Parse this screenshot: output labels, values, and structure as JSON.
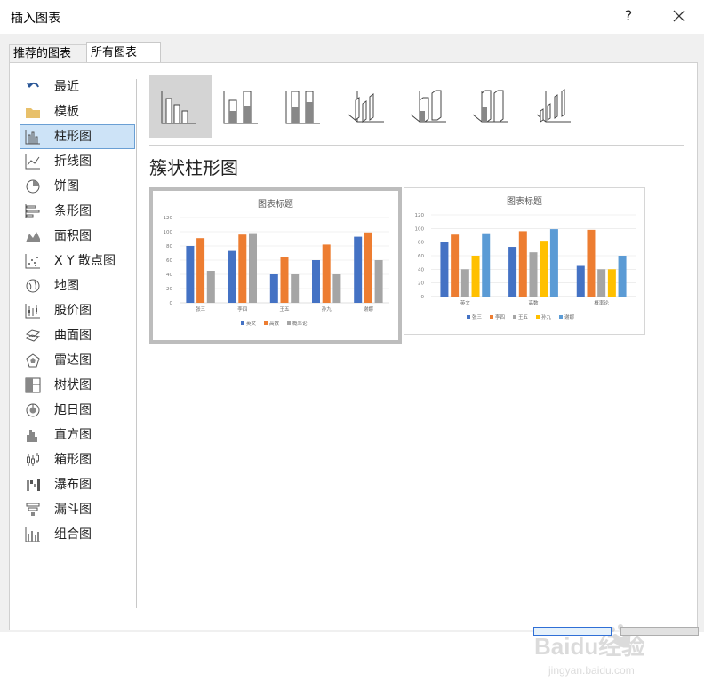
{
  "window": {
    "title": "插入图表",
    "help": "?",
    "close": "×"
  },
  "tabs": [
    {
      "label": "推荐的图表",
      "selected": false
    },
    {
      "label": "所有图表",
      "selected": true
    }
  ],
  "sidebar": {
    "items": [
      {
        "label": "最近",
        "icon": "undo-arrow-icon"
      },
      {
        "label": "模板",
        "icon": "folder-icon"
      },
      {
        "label": "柱形图",
        "icon": "column-chart-icon",
        "selected": true
      },
      {
        "label": "折线图",
        "icon": "line-chart-icon"
      },
      {
        "label": "饼图",
        "icon": "pie-chart-icon"
      },
      {
        "label": "条形图",
        "icon": "bar-chart-icon"
      },
      {
        "label": "面积图",
        "icon": "area-chart-icon"
      },
      {
        "label": "X Y 散点图",
        "icon": "scatter-chart-icon"
      },
      {
        "label": "地图",
        "icon": "map-globe-icon"
      },
      {
        "label": "股价图",
        "icon": "stock-chart-icon"
      },
      {
        "label": "曲面图",
        "icon": "surface-chart-icon"
      },
      {
        "label": "雷达图",
        "icon": "radar-chart-icon"
      },
      {
        "label": "树状图",
        "icon": "treemap-icon"
      },
      {
        "label": "旭日图",
        "icon": "sunburst-icon"
      },
      {
        "label": "直方图",
        "icon": "histogram-icon"
      },
      {
        "label": "箱形图",
        "icon": "box-whisker-icon"
      },
      {
        "label": "瀑布图",
        "icon": "waterfall-icon"
      },
      {
        "label": "漏斗图",
        "icon": "funnel-icon"
      },
      {
        "label": "组合图",
        "icon": "combo-chart-icon"
      }
    ]
  },
  "subtypes": [
    {
      "icon": "clustered-column-icon",
      "selected": true
    },
    {
      "icon": "stacked-column-icon"
    },
    {
      "icon": "100-stacked-column-icon"
    },
    {
      "icon": "3d-clustered-column-icon"
    },
    {
      "icon": "3d-stacked-column-icon"
    },
    {
      "icon": "3d-100-stacked-column-icon"
    },
    {
      "icon": "3d-column-icon"
    }
  ],
  "chart_type_heading": "簇状柱形图",
  "colors": {
    "blue": "#4472c4",
    "orange": "#ed7d31",
    "gray": "#a5a5a5",
    "yellow": "#ffc000",
    "lightblue": "#5b9bd5",
    "selection": "#cde3f7"
  },
  "chart_data": [
    {
      "type": "bar",
      "title": "图表标题",
      "categories": [
        "张三",
        "李四",
        "王五",
        "孙九",
        "谢娜"
      ],
      "series": [
        {
          "name": "英文",
          "values": [
            80,
            73,
            40,
            60,
            93
          ]
        },
        {
          "name": "高数",
          "values": [
            91,
            96,
            65,
            82,
            99
          ]
        },
        {
          "name": "概率论",
          "values": [
            45,
            98,
            40,
            40,
            60
          ]
        }
      ],
      "ylim": [
        0,
        120
      ],
      "yticks": [
        "0",
        "20",
        "40",
        "60",
        "80",
        "100",
        "120"
      ],
      "grid": true,
      "legend": "bottom"
    },
    {
      "type": "bar",
      "title": "图表标题",
      "categories": [
        "英文",
        "高数",
        "概率论"
      ],
      "series": [
        {
          "name": "张三",
          "values": [
            80,
            73,
            45
          ]
        },
        {
          "name": "李四",
          "values": [
            91,
            96,
            98
          ]
        },
        {
          "name": "王五",
          "values": [
            40,
            65,
            40
          ]
        },
        {
          "name": "孙九",
          "values": [
            60,
            82,
            40
          ]
        },
        {
          "name": "谢娜",
          "values": [
            93,
            99,
            60
          ]
        }
      ],
      "ylim": [
        0,
        120
      ],
      "yticks": [
        "0",
        "20",
        "40",
        "60",
        "80",
        "100",
        "120"
      ],
      "grid": true,
      "legend": "bottom"
    }
  ],
  "watermark": {
    "brand": "Baidu经验",
    "url": "jingyan.baidu.com"
  }
}
